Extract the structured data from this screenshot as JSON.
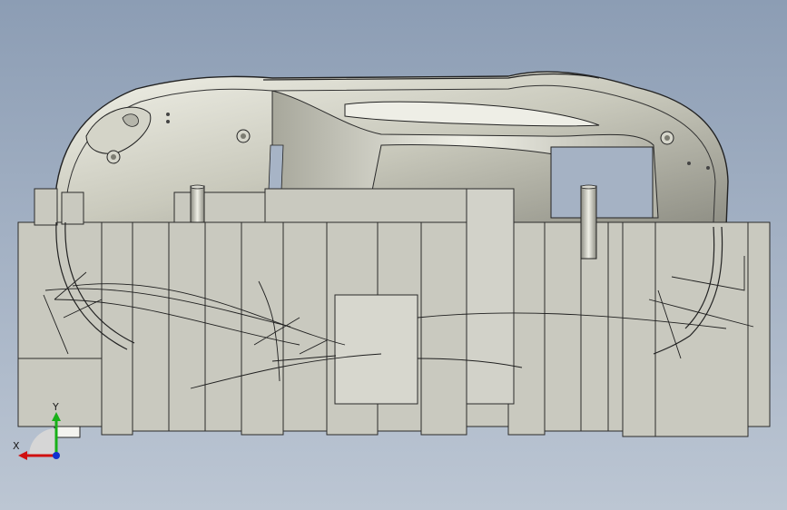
{
  "view": {
    "background_top": "#8c9db4",
    "background_bottom": "#bcc6d3",
    "part_fill": "#c9c9bf",
    "part_edge": "#2a2a2a",
    "shell_fill": "#d8d8cc"
  },
  "triad": {
    "x_label": "X",
    "y_label": "Y",
    "x_color": "#d01010",
    "y_color": "#18b018",
    "z_color": "#1030d0"
  }
}
